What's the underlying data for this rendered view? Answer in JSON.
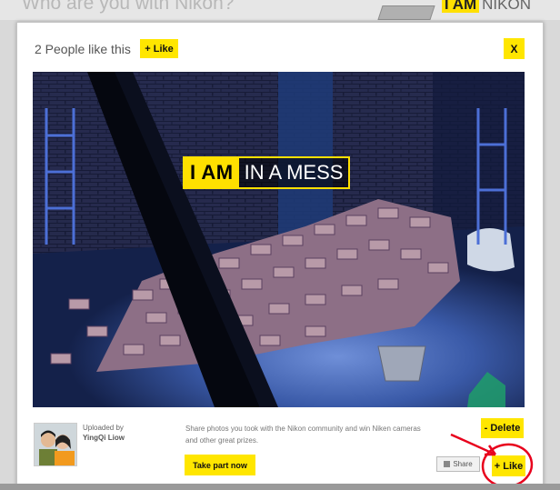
{
  "page": {
    "top_heading": "Who are you with Nikon?",
    "brand": {
      "i_am": "I AM",
      "name": "NIKON"
    }
  },
  "modal": {
    "likes_count": "2 People like this",
    "like_top_label": "+ Like",
    "close_label": "X",
    "photo": {
      "caption_i_am": "I AM",
      "caption_rest": "IN A MESS"
    },
    "footer": {
      "uploaded_by_label": "Uploaded by",
      "uploader_name": "YingQi Liow",
      "description": "Share photos you took with the Nikon community and win Niken cameras and other great prizes.",
      "delete_label": "- Delete",
      "take_part_label": "Take part now",
      "share_label": "Share",
      "like_bottom_label": "+ Like"
    }
  },
  "colors": {
    "accent_yellow": "#ffe600",
    "annotation_red": "#e8001c",
    "photo_blue": "#2a4f9e"
  }
}
